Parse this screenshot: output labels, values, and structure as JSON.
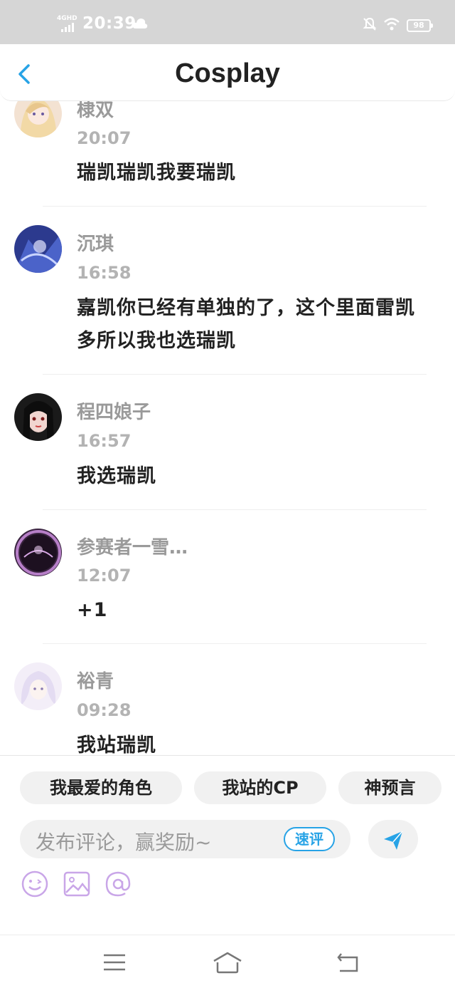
{
  "status_bar": {
    "network": "4GHD",
    "time": "20:39",
    "battery": "98"
  },
  "header": {
    "title": "Cosplay",
    "back_icon": "chevron-left-icon"
  },
  "comments": [
    {
      "name": "棣双",
      "time": "20:07",
      "text": "瑞凯瑞凯我要瑞凯"
    },
    {
      "name": "沉琪",
      "time": "16:58",
      "text": "嘉凯你已经有单独的了，这个里面雷凯多所以我也选瑞凯"
    },
    {
      "name": "程四娘子",
      "time": "16:57",
      "text": "我选瑞凯"
    },
    {
      "name": "参赛者一雪…",
      "time": "12:07",
      "text": "+1"
    },
    {
      "name": "裕青",
      "time": "09:28",
      "text": "我站瑞凯"
    }
  ],
  "tags": [
    "我最爱的角色",
    "我站的CP",
    "神预言"
  ],
  "composer": {
    "placeholder": "发布评论，赢奖励~",
    "quick_review": "速评"
  },
  "colors": {
    "accent": "#27a3e6",
    "tool_icon": "#c9a6e8"
  }
}
